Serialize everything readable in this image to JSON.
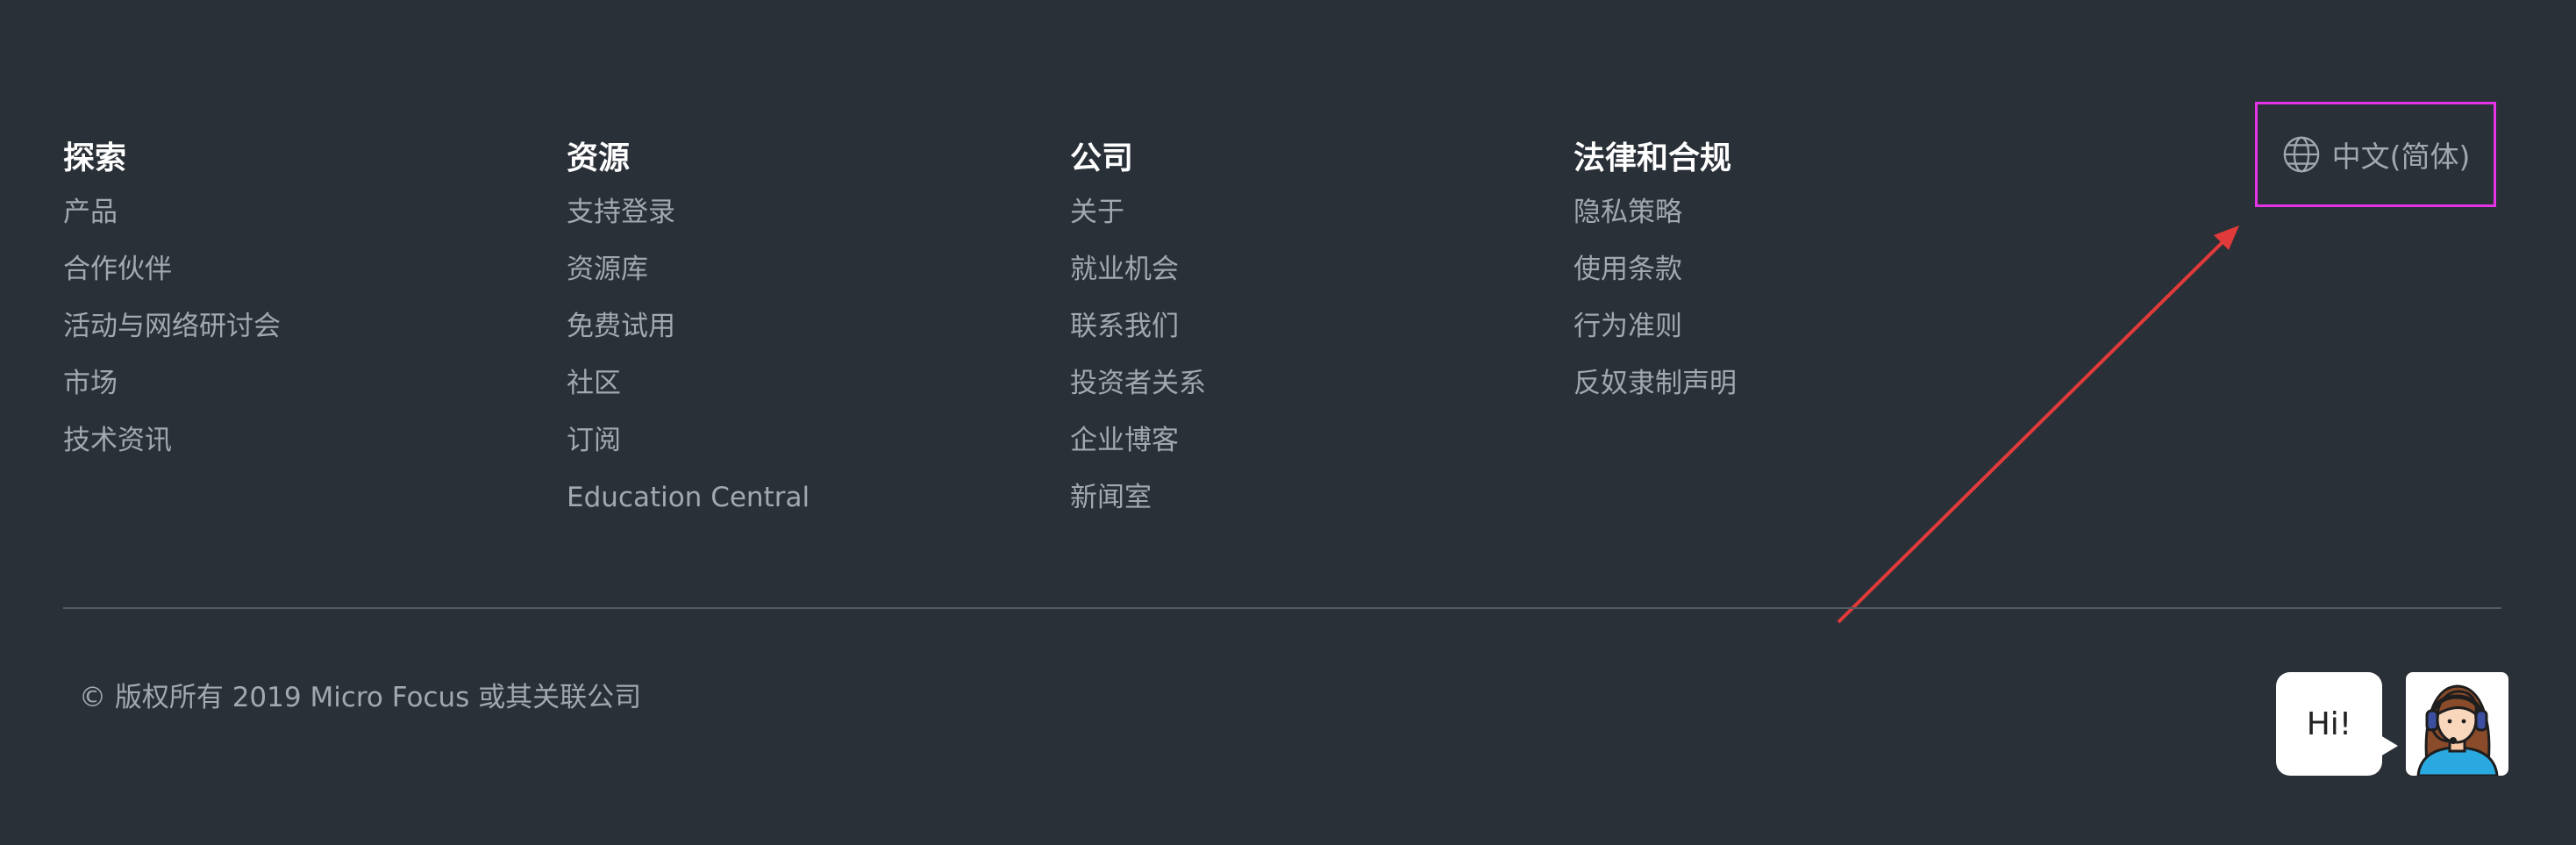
{
  "columns": [
    {
      "title": "探索",
      "links": [
        "产品",
        "合作伙伴",
        "活动与网络研讨会",
        "市场",
        "技术资讯"
      ]
    },
    {
      "title": "资源",
      "links": [
        "支持登录",
        "资源库",
        "免费试用",
        "社区",
        "订阅",
        "Education Central"
      ]
    },
    {
      "title": "公司",
      "links": [
        "关于",
        "就业机会",
        "联系我们",
        "投资者关系",
        "企业博客",
        "新闻室"
      ]
    },
    {
      "title": "法律和合规",
      "links": [
        "隐私策略",
        "使用条款",
        "行为准则",
        "反奴隶制声明"
      ]
    }
  ],
  "language": {
    "icon": "globe-icon",
    "label": "中文(简体)"
  },
  "copyright": "© 版权所有 2019 Micro Focus 或其关联公司",
  "chat": {
    "greeting": "Hi!",
    "avatar_icon": "support-agent-icon"
  },
  "colors": {
    "background": "#2a3038",
    "heading": "#ffffff",
    "link": "#a3a8b0",
    "highlight_border": "#e534e5",
    "annotation_arrow": "#e03a3a"
  }
}
